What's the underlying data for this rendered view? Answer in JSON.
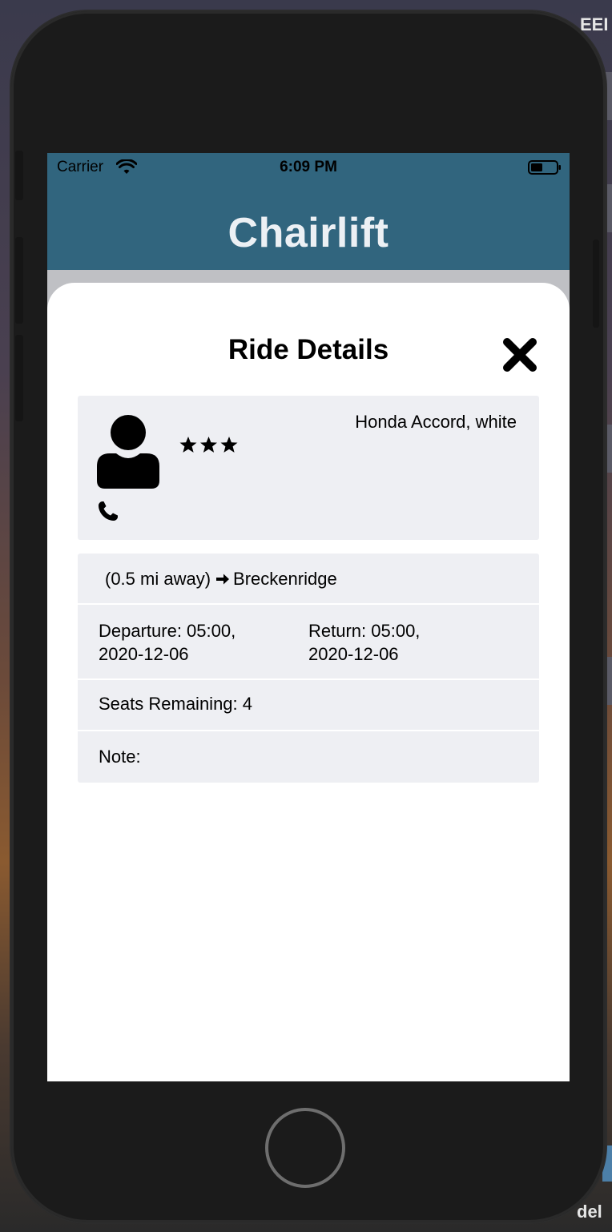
{
  "desktop": {
    "top_right_label": "EEI",
    "bottom_right_label": "del"
  },
  "status_bar": {
    "carrier": "Carrier",
    "time": "6:09 PM",
    "icons": [
      "wifi-icon",
      "battery-icon"
    ]
  },
  "app": {
    "title": "Chairlift"
  },
  "modal": {
    "title": "Ride Details",
    "close_icon": "close-icon",
    "driver": {
      "avatar_icon": "user-icon",
      "rating_stars": 3,
      "car": "Honda Accord, white",
      "contact_icon": "phone-icon"
    },
    "route": {
      "distance": "(0.5 mi away)",
      "arrow_icon": "arrow-right-icon",
      "destination": "Breckenridge"
    },
    "departure_label": "Departure: 05:00,",
    "departure_date": "2020-12-06",
    "return_label": "Return: 05:00,",
    "return_date": "2020-12-06",
    "seats_remaining": "Seats Remaining: 4",
    "note": "Note:"
  },
  "colors": {
    "header": "#31657e",
    "title_text": "#ecf0f4",
    "card_bg": "#eeeff3",
    "phone_body": "#1b1b1b"
  }
}
